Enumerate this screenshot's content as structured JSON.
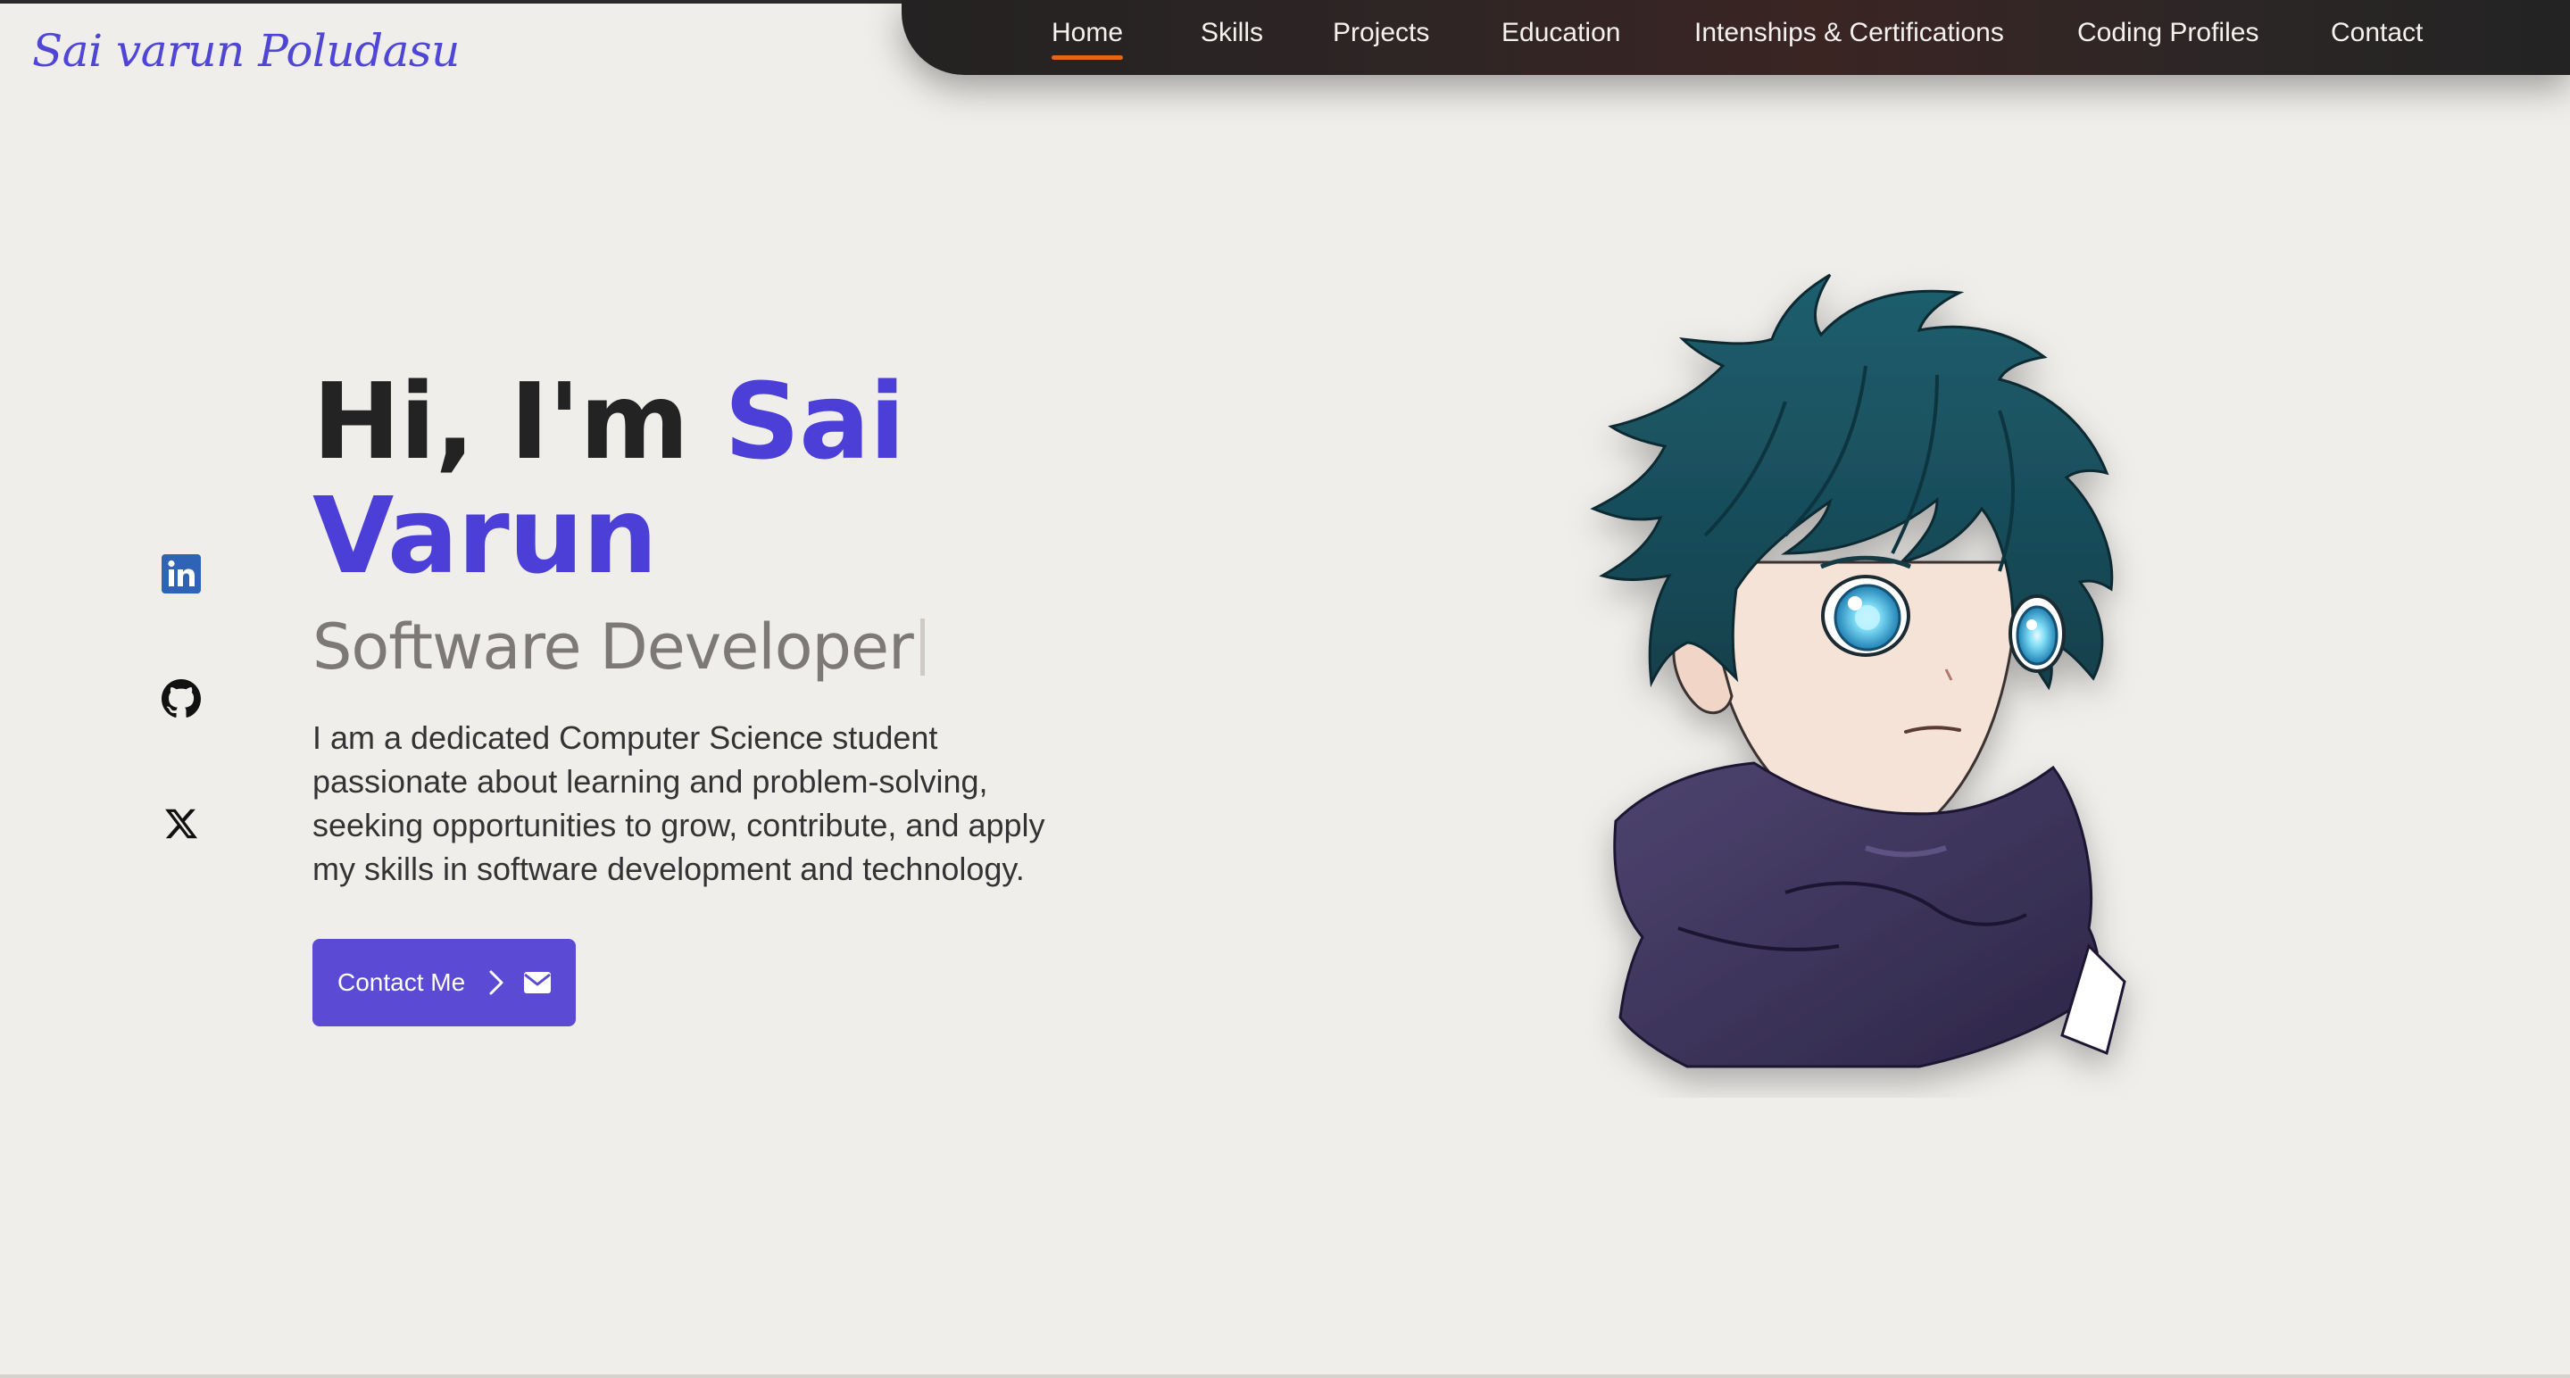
{
  "brand": {
    "name": "Sai varun Poludasu"
  },
  "nav": {
    "items": [
      {
        "label": "Home",
        "active": true
      },
      {
        "label": "Skills"
      },
      {
        "label": "Projects"
      },
      {
        "label": "Education"
      },
      {
        "label": "Intenships & Certifications"
      },
      {
        "label": "Coding Profiles"
      },
      {
        "label": "Contact"
      }
    ]
  },
  "social": {
    "icons": [
      "linkedin-icon",
      "github-icon",
      "x-icon"
    ]
  },
  "hero": {
    "greeting": "Hi, I'm ",
    "name": "Sai Varun",
    "role": "Software Developer",
    "intro": "I am a dedicated Computer Science student passionate about learning and problem-solving, seeking opportunities to grow, contribute, and apply my skills in software development and technology.",
    "cta_label": "Contact Me"
  },
  "colors": {
    "accent": "#4b3fd8",
    "button": "#5b4ad4",
    "nav_underline": "#e0671c",
    "background": "#f0eeeb",
    "navbar": "#2a2525"
  }
}
